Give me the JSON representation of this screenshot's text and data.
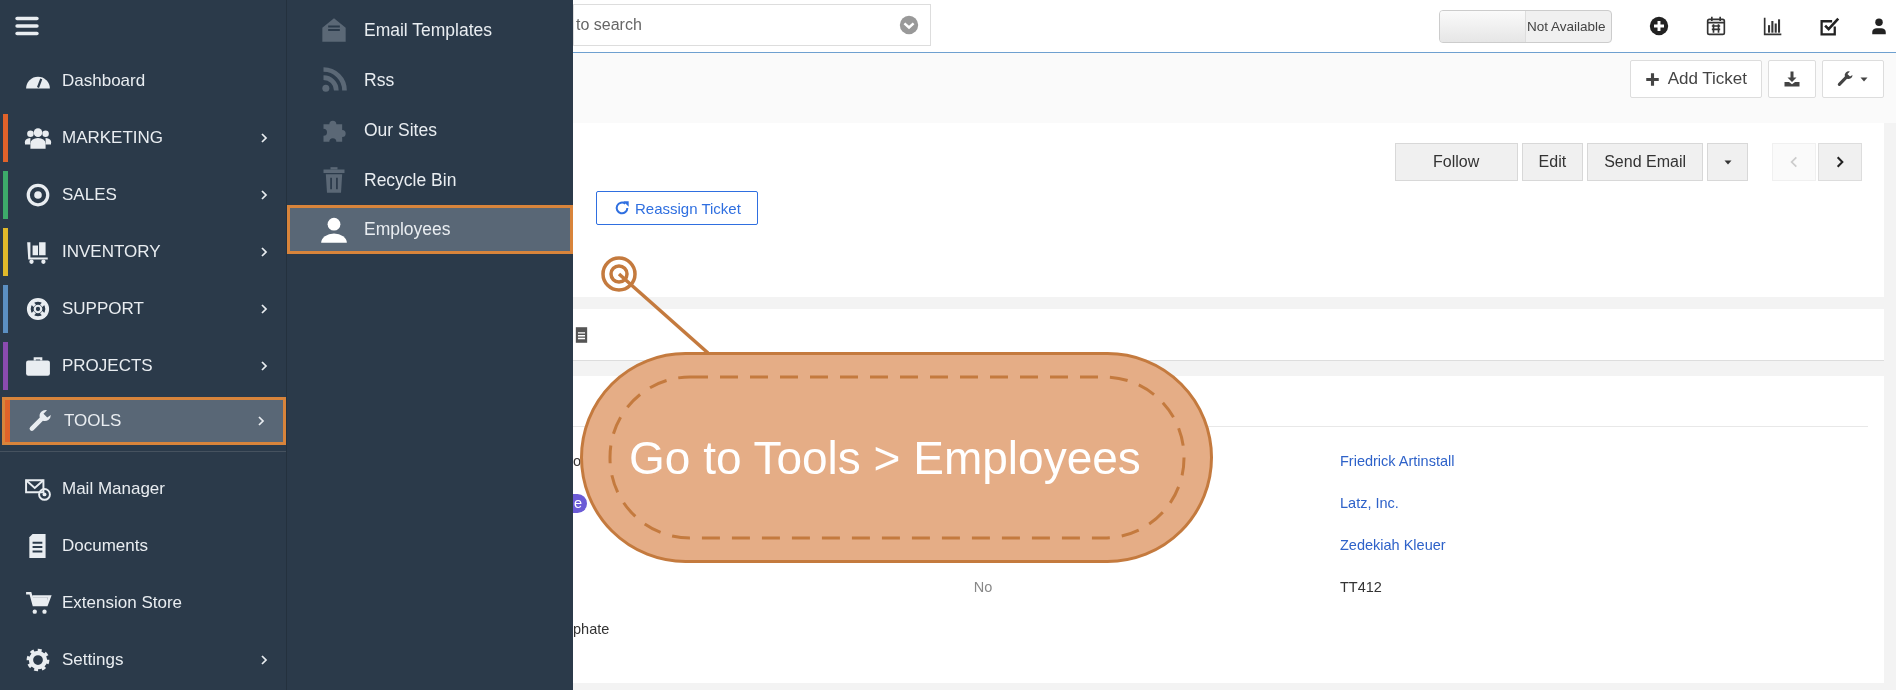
{
  "sidebar": {
    "items": [
      {
        "label": "Dashboard",
        "kind": "link",
        "has_submenu": false,
        "selected": false
      },
      {
        "label": "MARKETING",
        "kind": "module",
        "color": "#e0622a",
        "has_submenu": true,
        "selected": false
      },
      {
        "label": "SALES",
        "kind": "module",
        "color": "#3dab6a",
        "has_submenu": true,
        "selected": false
      },
      {
        "label": "INVENTORY",
        "kind": "module",
        "color": "#e0b92a",
        "has_submenu": true,
        "selected": false
      },
      {
        "label": "SUPPORT",
        "kind": "module",
        "color": "#5b8fc2",
        "has_submenu": true,
        "selected": false
      },
      {
        "label": "PROJECTS",
        "kind": "module",
        "color": "#8a4bb0",
        "has_submenu": true,
        "selected": false
      },
      {
        "label": "TOOLS",
        "kind": "module",
        "color": "#e0622a",
        "has_submenu": true,
        "selected": true
      },
      {
        "label": "Mail Manager",
        "kind": "link",
        "has_submenu": false,
        "selected": false
      },
      {
        "label": "Documents",
        "kind": "link",
        "has_submenu": false,
        "selected": false
      },
      {
        "label": "Extension Store",
        "kind": "link",
        "has_submenu": false,
        "selected": false
      },
      {
        "label": "Settings",
        "kind": "link",
        "has_submenu": true,
        "selected": false
      }
    ]
  },
  "submenu": {
    "items": [
      {
        "label": "Email Templates",
        "selected": false
      },
      {
        "label": "Rss",
        "selected": false
      },
      {
        "label": "Our Sites",
        "selected": false
      },
      {
        "label": "Recycle Bin",
        "selected": false
      },
      {
        "label": "Employees",
        "selected": true
      }
    ]
  },
  "topbar": {
    "search": {
      "placeholder": "to search"
    },
    "status": {
      "label": "Not Available"
    }
  },
  "toolbar": {
    "add_button": "Add Ticket"
  },
  "detail": {
    "actions": [
      "Follow",
      "Edit",
      "Send Email"
    ],
    "pager": {
      "previous": {
        "disabled": true
      },
      "next": {
        "disabled": false
      }
    },
    "reassign_button": "Reassign Ticket"
  },
  "details": [
    {
      "column_1": {
        "text": "o",
        "kind": "text"
      },
      "column_3": {
        "text": "Friedrick Artinstall",
        "kind": "link"
      }
    },
    {
      "column_1": {
        "text": "e",
        "kind": "badge"
      },
      "column_3": {
        "text": "Latz, Inc.",
        "kind": "link"
      }
    },
    {
      "column_3": {
        "text": "Zedekiah Kleuer",
        "kind": "link"
      }
    },
    {
      "column_2": {
        "text": "No",
        "kind": "muted"
      },
      "column_3": {
        "text": "TT412",
        "kind": "text"
      }
    },
    {
      "column_1": {
        "text": "phate",
        "kind": "text"
      }
    }
  ],
  "callout": {
    "text": "Go to Tools > Employees"
  }
}
